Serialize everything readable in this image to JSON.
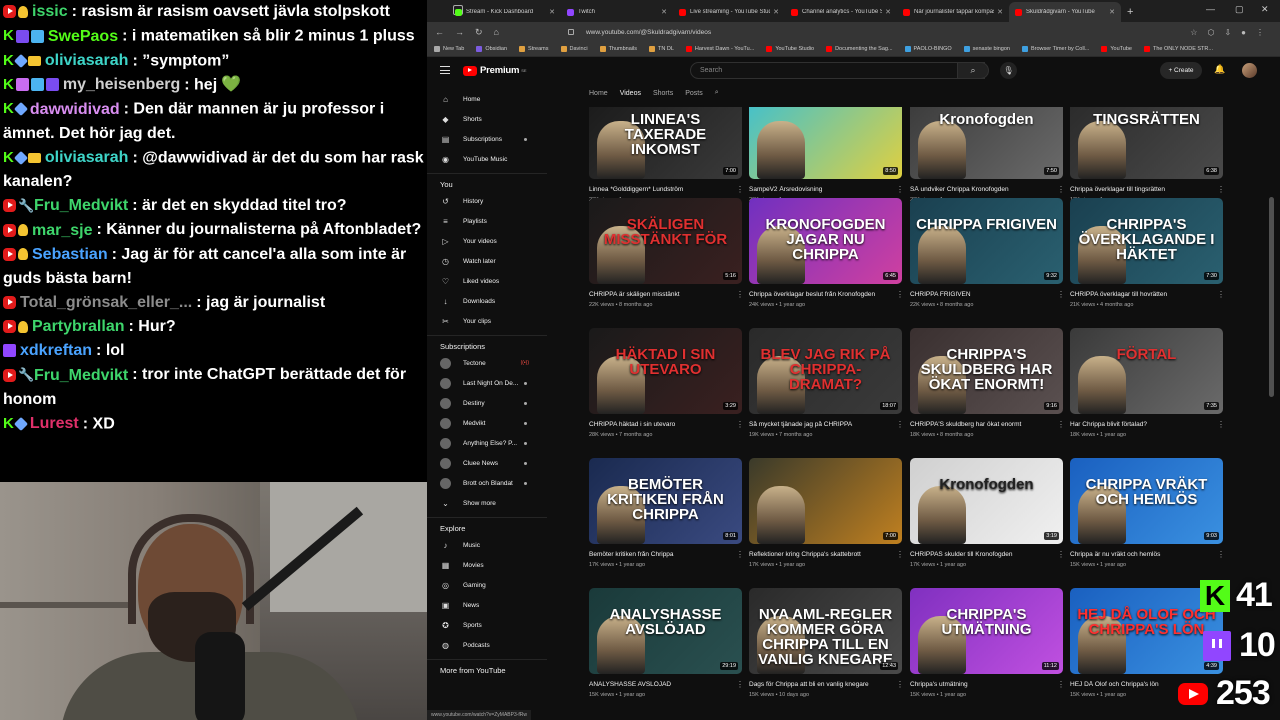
{
  "chat": [
    {
      "badges": [
        "yt",
        "bulb"
      ],
      "user": "issic",
      "user_color": "#3ed56b",
      "text": "rasism är rasism oavsett jävla stolpskott"
    },
    {
      "badges": [
        "kick",
        "cube",
        "grid"
      ],
      "user": "SwePaos",
      "user_color": "#53fc18",
      "text": "i matematiken så blir 2 minus 1 pluss"
    },
    {
      "badges": [
        "kick",
        "gem",
        "crown"
      ],
      "user": "oliviasarah",
      "user_color": "#3ed5c8",
      "text": "”symptom”"
    },
    {
      "badges": [
        "kick",
        "box",
        "grid",
        "cube"
      ],
      "user": "my_heisenberg",
      "user_color": "#cfcfcf",
      "text": "hej",
      "heart": "💚"
    },
    {
      "badges": [
        "kick",
        "gem"
      ],
      "user": "dawwidivad",
      "user_color": "#d88df0",
      "text": "Den där mannen är ju professor i ämnet. Det hör jag det."
    },
    {
      "badges": [
        "kick",
        "gem",
        "crown"
      ],
      "user": "oliviasarah",
      "user_color": "#3ed5c8",
      "text": "@dawwidivad är det du som har rask kanalen?"
    },
    {
      "badges": [
        "yt",
        "wrench"
      ],
      "user": "Fru_Medvikt",
      "user_color": "#3ed56b",
      "text": "är det en skyddad titel tro?"
    },
    {
      "badges": [
        "yt",
        "bulb"
      ],
      "user": "mar_sje",
      "user_color": "#3ed56b",
      "text": "Känner du journalisterna på Aftonbladet?"
    },
    {
      "badges": [
        "yt",
        "bulb"
      ],
      "user": "Sebastian",
      "user_color": "#4aa3ff",
      "text": "Jag är för att cancel'a alla som inte är guds bästa barn!"
    },
    {
      "badges": [
        "yt"
      ],
      "user": "Total_grönsak_eller_...",
      "user_color": "#8c8c8c",
      "text": "jag är journalist"
    },
    {
      "badges": [
        "yt",
        "bulb"
      ],
      "user": "Partybrallan",
      "user_color": "#3ed56b",
      "text": "Hur?"
    },
    {
      "badges": [
        "tw"
      ],
      "user": "xdkreftan",
      "user_color": "#4aa3ff",
      "text": "lol"
    },
    {
      "badges": [
        "yt",
        "wrench"
      ],
      "user": "Fru_Medvikt",
      "user_color": "#3ed56b",
      "text": "tror inte ChatGPT berättade det för honom"
    },
    {
      "badges": [
        "kick",
        "gem"
      ],
      "user": "Lurest",
      "user_color": "#e0306a",
      "text": "XD"
    }
  ],
  "browser": {
    "tabs": [
      {
        "title": "Stream - Kick Dashboard",
        "color": "#53fc18"
      },
      {
        "title": "Twitch",
        "color": "#9146ff"
      },
      {
        "title": "Live streaming - YouTube Studio",
        "color": "#ff0000"
      },
      {
        "title": "Channel analytics - YouTube St...",
        "color": "#ff0000"
      },
      {
        "title": "När journalister tappar kompass...",
        "color": "#ff0000"
      },
      {
        "title": "Skuldrådgivarn - YouTube",
        "color": "#ff0000",
        "active": true
      }
    ],
    "url": "www.youtube.com/@Skuldradgivarn/videos",
    "bookmarks": [
      {
        "label": "New Tab",
        "color": "#aaa"
      },
      {
        "label": "Obsidian",
        "color": "#7c5ce0"
      },
      {
        "label": "Streams",
        "color": "#e0a040"
      },
      {
        "label": "Davinci",
        "color": "#e0a040"
      },
      {
        "label": "Thumbnails",
        "color": "#e0a040"
      },
      {
        "label": "TN DL",
        "color": "#e0a040"
      },
      {
        "label": "Harvest Dawn - YouTu...",
        "color": "#ff0000"
      },
      {
        "label": "YouTube Studio",
        "color": "#ff0000"
      },
      {
        "label": "Documenting the Sag...",
        "color": "#ff0000"
      },
      {
        "label": "PAOLO-BINGO",
        "color": "#3ea0e0"
      },
      {
        "label": "senaste bingon",
        "color": "#3ea0e0"
      },
      {
        "label": "Browser Timer by Coll...",
        "color": "#3ea0e0"
      },
      {
        "label": "YouTube",
        "color": "#ff0000"
      },
      {
        "label": "The ONLY NODE STR...",
        "color": "#ff0000"
      }
    ],
    "status_url": "www.youtube.com/watch?v=ZyMABP3-fRw"
  },
  "yt": {
    "logo_text": "Premium",
    "logo_sup": "SE",
    "search_placeholder": "Search",
    "create_label": "+ Create",
    "sidebar_main": [
      {
        "label": "Home",
        "icon": "⌂",
        "icon_name": "home-icon"
      },
      {
        "label": "Shorts",
        "icon": "◆",
        "icon_name": "shorts-icon"
      },
      {
        "label": "Subscriptions",
        "icon": "▤",
        "icon_name": "subscriptions-icon",
        "dot": true
      }
    ],
    "sidebar_music": {
      "label": "YouTube Music",
      "icon": "◉",
      "icon_name": "music-icon"
    },
    "you_label": "You",
    "sidebar_you": [
      {
        "label": "History",
        "icon": "↺",
        "icon_name": "history-icon"
      },
      {
        "label": "Playlists",
        "icon": "≡",
        "icon_name": "playlists-icon"
      },
      {
        "label": "Your videos",
        "icon": "▷",
        "icon_name": "your-videos-icon"
      },
      {
        "label": "Watch later",
        "icon": "◷",
        "icon_name": "watch-later-icon"
      },
      {
        "label": "Liked videos",
        "icon": "♡",
        "icon_name": "liked-icon"
      },
      {
        "label": "Downloads",
        "icon": "↓",
        "icon_name": "downloads-icon"
      },
      {
        "label": "Your clips",
        "icon": "✂",
        "icon_name": "clips-icon"
      }
    ],
    "subs_label": "Subscriptions",
    "subscriptions": [
      {
        "label": "Tectone",
        "live": "((•))"
      },
      {
        "label": "Last Night On De...",
        "dot": true
      },
      {
        "label": "Destiny",
        "dot": true
      },
      {
        "label": "Medvikt",
        "dot": true
      },
      {
        "label": "Anything Else? P...",
        "dot": true
      },
      {
        "label": "Cluee News",
        "dot": true
      },
      {
        "label": "Brott och Blandat",
        "dot": true
      }
    ],
    "show_more": "Show more",
    "explore_label": "Explore",
    "explore": [
      {
        "label": "Music",
        "icon": "♪",
        "icon_name": "music-note-icon"
      },
      {
        "label": "Movies",
        "icon": "▦",
        "icon_name": "movies-icon"
      },
      {
        "label": "Gaming",
        "icon": "◎",
        "icon_name": "gaming-icon"
      },
      {
        "label": "News",
        "icon": "▣",
        "icon_name": "news-icon"
      },
      {
        "label": "Sports",
        "icon": "✪",
        "icon_name": "sports-icon"
      },
      {
        "label": "Podcasts",
        "icon": "◍",
        "icon_name": "podcasts-icon"
      }
    ],
    "more_from": "More from YouTube",
    "channel_tabs": [
      "Home",
      "Videos",
      "Shorts",
      "Posts"
    ],
    "active_tab": "Videos",
    "videos": [
      {
        "title": "Linnea *Golddiggern* Lundström",
        "meta": "23K views • 1 year ago",
        "dur": "7:00",
        "thumb_text": "LINNEA'S TAXERADE INKOMST",
        "bg": "linear-gradient(135deg,#1a1a1a,#3a3a3a)",
        "tcolor": "#fff"
      },
      {
        "title": "SampeV2 Årsredovisning",
        "meta": "26K views • 1 year ago",
        "dur": "8:50",
        "thumb_text": "",
        "bg": "linear-gradient(135deg,#3ec0d0,#e0d040)",
        "tcolor": "#fff"
      },
      {
        "title": "SÅ undviker Chrippa Kronofogden",
        "meta": "23K views • 1 year ago",
        "dur": "7:50",
        "thumb_text": "Kronofogden",
        "bg": "linear-gradient(135deg,#3a3a3a,#6a6a6a)",
        "tcolor": "#fff"
      },
      {
        "title": "Chrippa överklagar till tingsrätten",
        "meta": "12K views • 1 year ago",
        "dur": "6:38",
        "thumb_text": "TINGSRÄTTEN",
        "bg": "linear-gradient(135deg,#2a2a2a,#4a4a4a)",
        "tcolor": "#fff"
      },
      {
        "title": "CHRIPPA är skäligen misstänkt",
        "meta": "22K views • 8 months ago",
        "dur": "5:16",
        "thumb_text": "SKÄLIGEN MISSTÄNKT FÖR",
        "bg": "linear-gradient(135deg,#1a1a1a,#3a2020)",
        "tcolor": "#e03030"
      },
      {
        "title": "Chrippa överklagar beslut från Kronofogden",
        "meta": "24K views • 1 year ago",
        "dur": "6:45",
        "thumb_text": "KRONOFOGDEN JAGAR NU CHRIPPA",
        "bg": "linear-gradient(135deg,#7030c0,#d040a0)",
        "tcolor": "#fff"
      },
      {
        "title": "CHRIPPA FRIGIVEN",
        "meta": "22K views • 8 months ago",
        "dur": "9:32",
        "thumb_text": "CHRIPPA FRIGIVEN",
        "bg": "linear-gradient(135deg,#1a4050,#2a6070)",
        "tcolor": "#fff"
      },
      {
        "title": "CHRIPPA överklagar till hovrätten",
        "meta": "21K views • 4 months ago",
        "dur": "7:30",
        "thumb_text": "CHRIPPA'S ÖVERKLAGANDE I HÄKTET",
        "bg": "linear-gradient(135deg,#1a4050,#2a6070)",
        "tcolor": "#fff"
      },
      {
        "title": "CHRIPPA häktad i sin utevaro",
        "meta": "28K views • 7 months ago",
        "dur": "3:29",
        "thumb_text": "HÄKTAD I SIN UTEVARO",
        "bg": "linear-gradient(135deg,#1a1a1a,#3a2020)",
        "tcolor": "#e03030"
      },
      {
        "title": "Så mycket tjänade jag på CHRIPPA",
        "meta": "19K views • 7 months ago",
        "dur": "18:07",
        "thumb_text": "BLEV JAG RIK PÅ CHRIPPA-DRAMAT?",
        "bg": "linear-gradient(135deg,#2a2a2a,#3a3a3a)",
        "tcolor": "#e03030"
      },
      {
        "title": "CHRIPPA'S skuldberg har ökat enormt",
        "meta": "18K views • 8 months ago",
        "dur": "9:16",
        "thumb_text": "CHRIPPA'S SKULDBERG HAR ÖKAT ENORMT!",
        "bg": "linear-gradient(135deg,#3a3030,#5a5050)",
        "tcolor": "#fff"
      },
      {
        "title": "Har Chrippa blivit förtalad?",
        "meta": "18K views • 1 year ago",
        "dur": "7:35",
        "thumb_text": "FÖRTAL",
        "bg": "linear-gradient(135deg,#3a3a3a,#6a6a6a)",
        "tcolor": "#e03030"
      },
      {
        "title": "Bemöter kritiken från Chrippa",
        "meta": "17K views • 1 year ago",
        "dur": "8:01",
        "thumb_text": "BEMÖTER KRITIKEN FRÅN CHRIPPA",
        "bg": "linear-gradient(135deg,#1a2a50,#3a4a80)",
        "tcolor": "#fff"
      },
      {
        "title": "Reflektioner kring Chrippa's skattebrott",
        "meta": "17K views • 1 year ago",
        "dur": "7:00",
        "thumb_text": "",
        "bg": "linear-gradient(135deg,#3a3a2a,#c08020)",
        "tcolor": "#fff"
      },
      {
        "title": "CHRIPPAS skulder till Kronofogden",
        "meta": "17K views • 1 year ago",
        "dur": "3:19",
        "thumb_text": "Kronofogden",
        "bg": "linear-gradient(135deg,#d0d0d0,#f0f0f0)",
        "tcolor": "#222"
      },
      {
        "title": "Chrippa är nu vräkt och hemlös",
        "meta": "15K views • 1 year ago",
        "dur": "9:03",
        "thumb_text": "CHRIPPA VRÄKT OCH HEMLÖS",
        "bg": "linear-gradient(135deg,#1a60c0,#3a90e0)",
        "tcolor": "#fff"
      },
      {
        "title": "ANALYSHASSE AVSLÖJAD",
        "meta": "15K views • 1 year ago",
        "dur": "29:19",
        "thumb_text": "ANALYSHASSE AVSLÖJAD",
        "bg": "linear-gradient(135deg,#1a3a3a,#2a5050)",
        "tcolor": "#fff"
      },
      {
        "title": "Dags för Chrippa att bli en vanlig knegare",
        "meta": "15K views • 10 days ago",
        "dur": "12:43",
        "thumb_text": "NYA AML-REGLER KOMMER GÖRA CHRIPPA TILL EN VANLIG KNEGARE",
        "bg": "linear-gradient(135deg,#2a2a2a,#4a4a4a)",
        "tcolor": "#fff"
      },
      {
        "title": "Chrippa's utmätning",
        "meta": "15K views • 1 year ago",
        "dur": "11:12",
        "thumb_text": "CHRIPPA'S UTMÄTNING",
        "bg": "linear-gradient(135deg,#8030c0,#c050e0)",
        "tcolor": "#fff"
      },
      {
        "title": "HEJ DÅ Olof och Chrippa's lön",
        "meta": "15K views • 1 year ago",
        "dur": "4:39",
        "thumb_text": "HEJ DÅ OLOF OCH CHRIPPA'S LÖN",
        "bg": "linear-gradient(135deg,#1a60c0,#3a90e0)",
        "tcolor": "#ff3030"
      }
    ]
  },
  "viewers": {
    "kick": "41",
    "twitch": "10",
    "youtube": "253"
  }
}
